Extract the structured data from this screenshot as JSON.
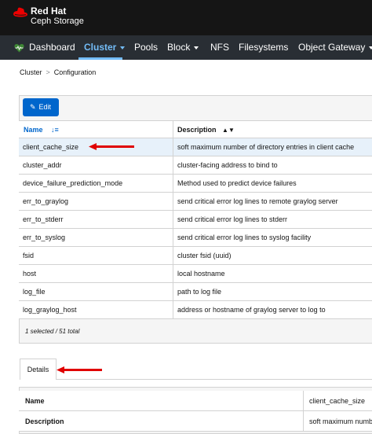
{
  "brand": {
    "name": "Red Hat",
    "product": "Ceph Storage",
    "logo_icon": "red-hat-logo"
  },
  "nav": {
    "items": [
      {
        "label": "Dashboard",
        "icon": "heartbeat-icon"
      },
      {
        "label": "Cluster",
        "active": true,
        "dropdown": true
      },
      {
        "label": "Pools"
      },
      {
        "label": "Block",
        "dropdown": true
      },
      {
        "label": "NFS"
      },
      {
        "label": "Filesystems"
      },
      {
        "label": "Object Gateway",
        "dropdown": true
      }
    ]
  },
  "breadcrumb": {
    "items": [
      "Cluster",
      "Configuration"
    ],
    "separator": ">"
  },
  "toolbar": {
    "edit_label": "Edit"
  },
  "table": {
    "columns": [
      {
        "label": "Name",
        "sort": "ascending"
      },
      {
        "label": "Description",
        "sort": "sortable"
      }
    ],
    "rows": [
      {
        "name": "client_cache_size",
        "description": "soft maximum number of directory entries in client cache",
        "selected": true
      },
      {
        "name": "cluster_addr",
        "description": "cluster-facing address to bind to"
      },
      {
        "name": "device_failure_prediction_mode",
        "description": "Method used to predict device failures"
      },
      {
        "name": "err_to_graylog",
        "description": "send critical error log lines to remote graylog server"
      },
      {
        "name": "err_to_stderr",
        "description": "send critical error log lines to stderr"
      },
      {
        "name": "err_to_syslog",
        "description": "send critical error log lines to syslog facility"
      },
      {
        "name": "fsid",
        "description": "cluster fsid (uuid)"
      },
      {
        "name": "host",
        "description": "local hostname"
      },
      {
        "name": "log_file",
        "description": "path to log file"
      },
      {
        "name": "log_graylog_host",
        "description": "address or hostname of graylog server to log to"
      }
    ],
    "status": "1 selected / 51 total"
  },
  "details": {
    "tab_label": "Details",
    "rows": [
      {
        "label": "Name",
        "value": "client_cache_size"
      },
      {
        "label": "Description",
        "value": "soft maximum numb"
      }
    ]
  },
  "colors": {
    "brand_bar": "#151515",
    "nav_bar": "#292e34",
    "nav_active": "#73bcf7",
    "primary": "#0066cc",
    "selected_row": "#e7f1fa",
    "annotation_arrow": "#e00000",
    "logo_red": "#ee0000",
    "heart_green": "#3e8635"
  }
}
